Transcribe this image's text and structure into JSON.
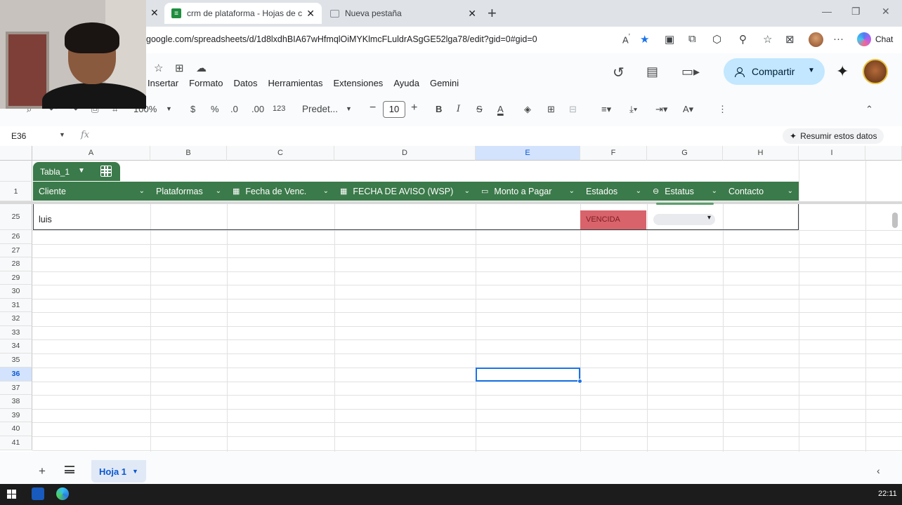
{
  "browser": {
    "tabs": [
      {
        "title": "crm de plataforma - Hojas de cálc",
        "active": true
      },
      {
        "title": "Nueva pestaña",
        "active": false
      }
    ],
    "url": "google.com/spreadsheets/d/1d8lxdhBIA67wHfmqlOiMYKlmcFLuldrASgGE52lga78/edit?gid=0#gid=0",
    "copilot_label": "Chat"
  },
  "sheets": {
    "menu": [
      "Insertar",
      "Formato",
      "Datos",
      "Herramientas",
      "Extensiones",
      "Ayuda",
      "Gemini"
    ],
    "share_label": "Compartir",
    "toolbar": {
      "zoom": "100%",
      "currency": "$",
      "percent": "%",
      "decrease_decimals": ".0",
      "increase_decimals": ".00",
      "number_format": "123",
      "font": "Predet...",
      "font_size": "10"
    },
    "name_box": "E36",
    "fx_label": "fx",
    "summarize_label": "Resumir estos datos",
    "columns": [
      "A",
      "B",
      "C",
      "D",
      "E",
      "F",
      "G",
      "H",
      "I"
    ],
    "selected_column": "E",
    "rows": [
      "1",
      "25",
      "26",
      "27",
      "28",
      "29",
      "30",
      "31",
      "32",
      "33",
      "34",
      "35",
      "36",
      "37",
      "38",
      "39",
      "40",
      "41"
    ],
    "selected_row": "36",
    "table_name": "Tabla_1",
    "table_headers": [
      {
        "label": "Cliente",
        "icon": ""
      },
      {
        "label": "Plataformas",
        "icon": ""
      },
      {
        "label": "Fecha de Venc.",
        "icon": "calendar-icon"
      },
      {
        "label": "FECHA DE AVISO (WSP)",
        "icon": "calendar-icon"
      },
      {
        "label": "Monto a Pagar",
        "icon": "money-icon"
      },
      {
        "label": "Estados",
        "icon": ""
      },
      {
        "label": "Estatus",
        "icon": "chip-icon"
      },
      {
        "label": "Contacto",
        "icon": ""
      }
    ],
    "row25": {
      "cliente": "luis",
      "estado": "VENCIDA"
    },
    "sheet_tab": "Hoja 1"
  },
  "taskbar": {
    "clock": "22:11"
  },
  "colors": {
    "table_green": "#3b7a4a",
    "vencida_red": "#d9636b",
    "selection_blue": "#1a73e8",
    "share_bg": "#c2e7ff"
  }
}
